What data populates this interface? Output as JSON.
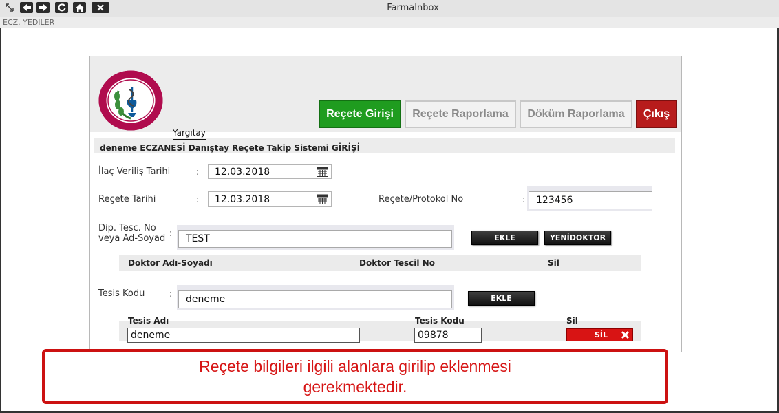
{
  "window": {
    "title": "FarmaInbox",
    "pharmacy_name": "ECZ. YEDILER",
    "controls": [
      "resize-icon",
      "back-arrow-icon",
      "forward-arrow-icon",
      "refresh-icon",
      "home-icon",
      "close-icon"
    ]
  },
  "header": {
    "logo": "turk-eczacilari-birligi-logo",
    "nav": {
      "recete_girisi": "Reçete Girişi",
      "recete_raporlama": "Reçete Raporlama",
      "dokum_raporlama": "Döküm Raporlama",
      "cikis": "Çıkış"
    },
    "yargitay_label": "Yargıtay"
  },
  "info_bar": {
    "text": "deneme ECZANESİ Danıştay Reçete Takip Sistemi GİRİŞİ"
  },
  "form": {
    "ilac_verilis_tarihi": {
      "label": "İlaç Veriliş Tarihi",
      "value": "12.03.2018"
    },
    "recete_tarihi": {
      "label": "Reçete Tarihi",
      "value": "12.03.2018"
    },
    "recete_protokol_no": {
      "label": "Reçete/Protokol No",
      "value": "123456"
    },
    "doctor": {
      "label_line1": "Dip. Tesc. No",
      "label_line2": "veya Ad-Soyad",
      "value": "TEST",
      "add_button": "EKLE",
      "new_doctor_button": "YENİDOKTOR"
    },
    "doctor_table": {
      "headers": [
        "Doktor Adı-Soyadı",
        "Doktor Tescil No",
        "Sil"
      ]
    },
    "tesis": {
      "label": "Tesis Kodu",
      "value": "deneme",
      "add_button": "EKLE"
    },
    "tesis_table": {
      "headers": [
        "Tesis Adı",
        "Tesis Kodu",
        "Sil"
      ],
      "rows": [
        {
          "tesis_adi": "deneme",
          "tesis_kodu": "09878",
          "delete_label": "SİL"
        }
      ]
    },
    "colon": ":"
  },
  "callout": {
    "text": "Reçete bilgileri ilgili alanlara girilip eklenmesi gerekmektedir.",
    "color": "#d61515"
  },
  "colors": {
    "active_nav": "#1f9c1f",
    "exit_nav": "#b71c1c",
    "delete_button": "#d81414"
  }
}
